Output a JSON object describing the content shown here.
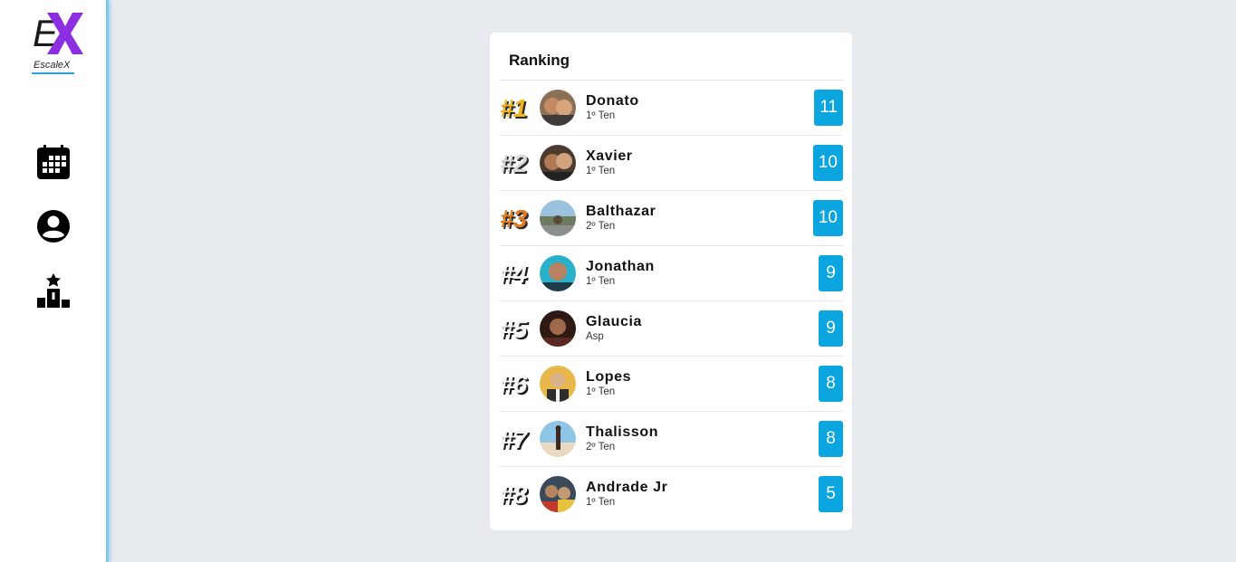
{
  "app": {
    "logo_letter": "E",
    "logo_name": "EscaleX",
    "colors": {
      "logo_x": "#8b2fe0",
      "accent": "#0ba5df",
      "sidebar_edge": "#7fc9ea"
    }
  },
  "sidebar": {
    "items": [
      {
        "icon": "calendar-icon"
      },
      {
        "icon": "account-circle-icon"
      },
      {
        "icon": "podium-star-icon"
      }
    ]
  },
  "ranking": {
    "title": "Ranking",
    "entries": [
      {
        "rank": "#1",
        "name": "Donato",
        "grade": "1º Ten",
        "score": "11",
        "medal": "gold"
      },
      {
        "rank": "#2",
        "name": "Xavier",
        "grade": "1º Ten",
        "score": "10",
        "medal": "silver"
      },
      {
        "rank": "#3",
        "name": "Balthazar",
        "grade": "2º Ten",
        "score": "10",
        "medal": "bronze"
      },
      {
        "rank": "#4",
        "name": "Jonathan",
        "grade": "1º Ten",
        "score": "9",
        "medal": "plain"
      },
      {
        "rank": "#5",
        "name": "Glaucia",
        "grade": "Asp",
        "score": "9",
        "medal": "plain"
      },
      {
        "rank": "#6",
        "name": "Lopes",
        "grade": "1º Ten",
        "score": "8",
        "medal": "plain"
      },
      {
        "rank": "#7",
        "name": "Thalisson",
        "grade": "2º Ten",
        "score": "8",
        "medal": "plain"
      },
      {
        "rank": "#8",
        "name": "Andrade Jr",
        "grade": "1º Ten",
        "score": "5",
        "medal": "plain"
      }
    ]
  }
}
